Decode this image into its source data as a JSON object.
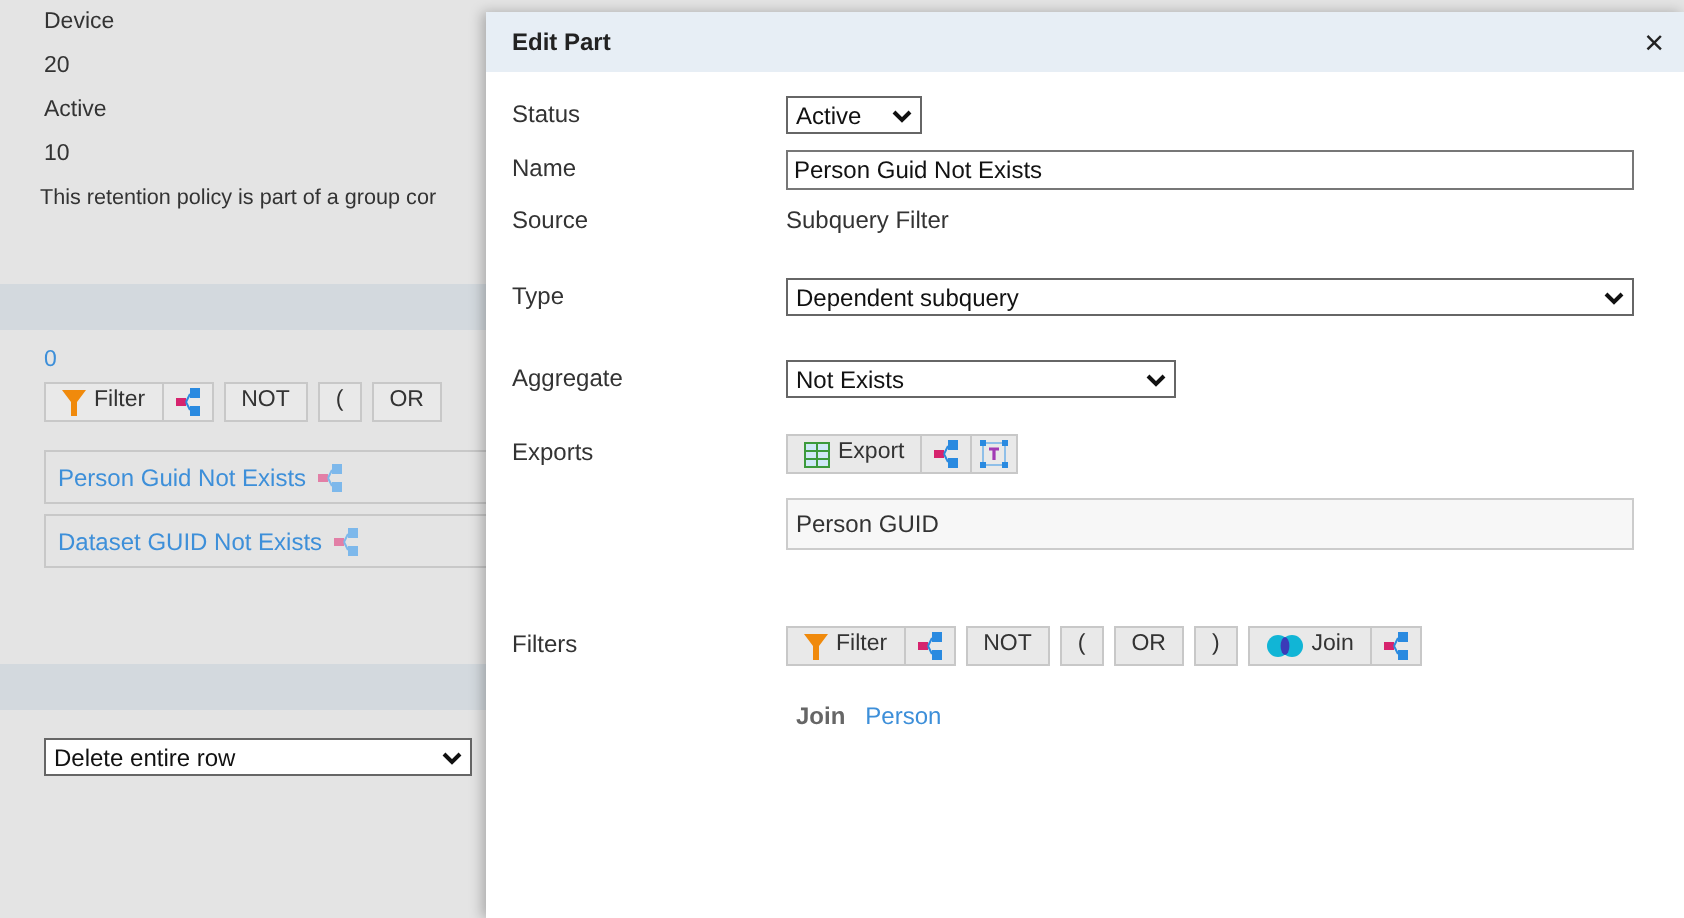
{
  "background": {
    "lines": [
      "Device",
      "20",
      "Active",
      "10",
      "This retention policy is part of a group cor"
    ],
    "count": "0",
    "toolbar": [
      {
        "kind": "filter",
        "label": "Filter"
      },
      {
        "kind": "text",
        "label": "NOT"
      },
      {
        "kind": "text",
        "label": "("
      },
      {
        "kind": "text",
        "label": "OR"
      }
    ],
    "parts": [
      "Person Guid Not Exists",
      "Dataset GUID Not Exists"
    ],
    "action_select": {
      "value": "Delete entire row"
    }
  },
  "dialog": {
    "title": "Edit Part",
    "close": "×",
    "fields": [
      {
        "kind": "select",
        "label": "Status",
        "value": "Active"
      },
      {
        "kind": "input",
        "label": "Name",
        "value": "Person Guid Not Exists"
      },
      {
        "kind": "text",
        "label": "Source",
        "value": "Subquery Filter"
      },
      {
        "kind": "select",
        "label": "Type",
        "value": "Dependent subquery"
      },
      {
        "kind": "select",
        "label": "Aggregate",
        "value": "Not Exists"
      },
      {
        "kind": "exports",
        "label": "Exports",
        "button": "Export",
        "value": "Person GUID"
      },
      {
        "kind": "filters",
        "label": "Filters",
        "toolbar": [
          {
            "kind": "filter",
            "label": "Filter"
          },
          {
            "kind": "text",
            "label": "NOT"
          },
          {
            "kind": "text",
            "label": "("
          },
          {
            "kind": "text",
            "label": "OR"
          },
          {
            "kind": "text",
            "label": ")"
          },
          {
            "kind": "join",
            "label": "Join"
          }
        ],
        "join": {
          "label": "Join",
          "link": "Person"
        }
      }
    ]
  }
}
